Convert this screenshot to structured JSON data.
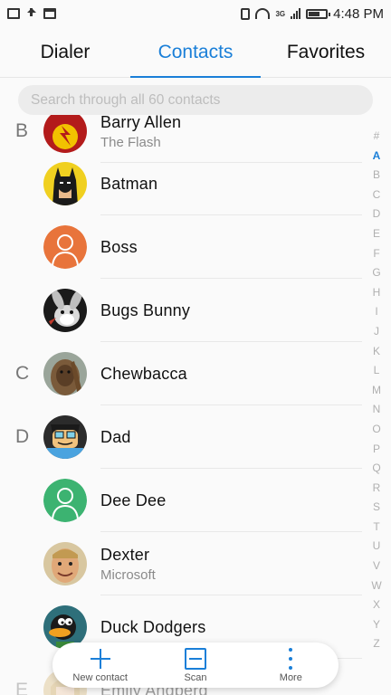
{
  "status_bar": {
    "time": "4:48 PM",
    "network_label": "3G",
    "left_icons": [
      "gmail-icon",
      "upload-icon",
      "notification-icon"
    ],
    "right_icons": [
      "vibrate-icon",
      "wifi-icon",
      "signal-icon",
      "battery-icon"
    ]
  },
  "tabs": [
    {
      "label": "Dialer",
      "active": false
    },
    {
      "label": "Contacts",
      "active": true
    },
    {
      "label": "Favorites",
      "active": false
    }
  ],
  "search": {
    "placeholder": "Search through all 60 contacts"
  },
  "contacts": [
    {
      "letter": "B",
      "name": "Barry Allen",
      "subtitle": "The Flash",
      "avatar": "flash-avatar"
    },
    {
      "letter": "",
      "name": "Batman",
      "subtitle": "",
      "avatar": "batman-avatar"
    },
    {
      "letter": "",
      "name": "Boss",
      "subtitle": "",
      "avatar": "placeholder-avatar-orange"
    },
    {
      "letter": "",
      "name": "Bugs Bunny",
      "subtitle": "",
      "avatar": "bugs-bunny-avatar"
    },
    {
      "letter": "C",
      "name": "Chewbacca",
      "subtitle": "",
      "avatar": "chewbacca-avatar"
    },
    {
      "letter": "D",
      "name": "Dad",
      "subtitle": "",
      "avatar": "dad-avatar"
    },
    {
      "letter": "",
      "name": "Dee Dee",
      "subtitle": "",
      "avatar": "placeholder-avatar-green"
    },
    {
      "letter": "",
      "name": "Dexter",
      "subtitle": "Microsoft",
      "avatar": "dexter-avatar"
    },
    {
      "letter": "",
      "name": "Duck Dodgers",
      "subtitle": "",
      "avatar": "duck-dodgers-avatar"
    },
    {
      "letter": "E",
      "name": "Emily Andberg",
      "subtitle": "",
      "avatar": "emily-avatar"
    }
  ],
  "alphabet_index": [
    "#",
    "A",
    "B",
    "C",
    "D",
    "E",
    "F",
    "G",
    "H",
    "I",
    "J",
    "K",
    "L",
    "M",
    "N",
    "O",
    "P",
    "Q",
    "R",
    "S",
    "T",
    "U",
    "V",
    "W",
    "X",
    "Y",
    "Z"
  ],
  "active_index_letter": "A",
  "actions": [
    {
      "label": "New contact",
      "icon": "plus-icon"
    },
    {
      "label": "Scan",
      "icon": "scan-icon"
    },
    {
      "label": "More",
      "icon": "more-vert-icon"
    }
  ],
  "colors": {
    "accent": "#1a7fd8",
    "boss_avatar": "#e8743b",
    "deedee_avatar": "#3cb371"
  }
}
